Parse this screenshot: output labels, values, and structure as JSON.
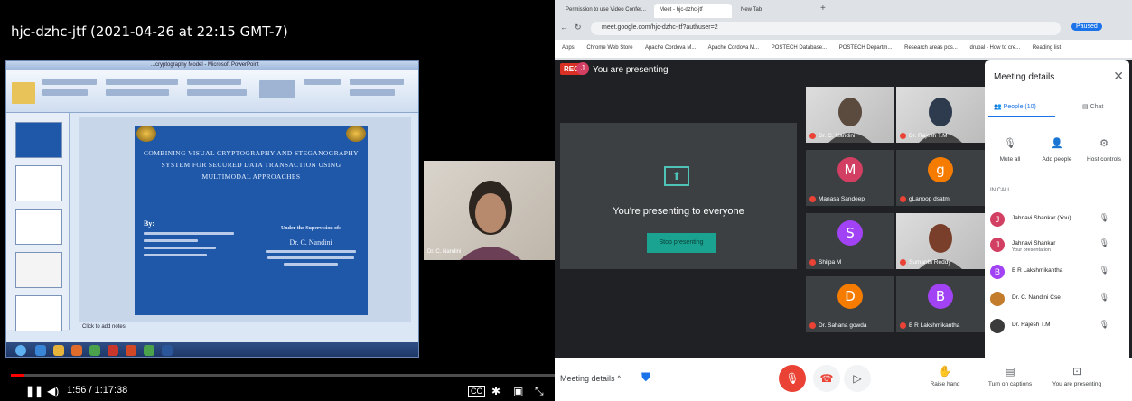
{
  "youtube": {
    "title": "hjc-dzhc-jtf (2021-04-26 at 22:15 GMT-7)",
    "time": "1:56 / 1:17:38",
    "progress_fraction": 0.025,
    "progress_color": "#ff0000"
  },
  "ppt": {
    "window_title": "...cryptography Model - Microsoft PowerPoint",
    "slide_title": "COMBINING VISUAL CRYPTOGRAPHY AND STEGANOGRAPHY SYSTEM FOR SECURED DATA TRANSACTION USING MULTIMODAL APPROACHES",
    "by_label": "By:",
    "supervision": "Under the Supervision of:",
    "supervisor": "Dr. C. Nandini",
    "notes": "Click to add notes"
  },
  "cam_left": {
    "name": "Dr. C. Nandini"
  },
  "browser": {
    "tabs": [
      "Permission to use Video Confer...",
      "Meet - hjc-dzhc-jtf",
      "New Tab"
    ],
    "url": "meet.google.com/hjc-dzhc-jtf?authuser=2",
    "paused_label": "Paused",
    "bookmarks": [
      "Apps",
      "Chrome Web Store",
      "Apache Cordova M...",
      "Apache Cordova M...",
      "POSTECH Database...",
      "POSTECH Departm...",
      "Research areas pos...",
      "drupal - How to cre..."
    ],
    "reading_list": "Reading list"
  },
  "meet": {
    "rec_label": "REC",
    "presenter_initial": "J",
    "you_presenting": "You are presenting",
    "presenting_text": "You're presenting to everyone",
    "stop_button": "Stop presenting",
    "tiles": [
      {
        "name": "Dr. C. Nandini",
        "initial": "",
        "color": "#5b4a3e",
        "video": true
      },
      {
        "name": "Dr. Rajesh T.M",
        "initial": "",
        "color": "#2e3b4e",
        "video": true
      },
      {
        "name": "Manasa Sandeep",
        "initial": "M",
        "color": "#d23f62"
      },
      {
        "name": "gLanoop dsatm",
        "initial": "g",
        "color": "#f57c00"
      },
      {
        "name": "Shilpa M",
        "initial": "S",
        "color": "#a142f4"
      },
      {
        "name": "Sumanth Reddy",
        "initial": "",
        "color": "#7a3f2a",
        "video": true
      },
      {
        "name": "Dr. Sahana gowda",
        "initial": "D",
        "color": "#f57c00"
      },
      {
        "name": "B R Lakshmikantha",
        "initial": "B",
        "color": "#a142f4"
      }
    ]
  },
  "sidebar": {
    "title": "Meeting details",
    "tab_people": "People (10)",
    "tab_chat": "Chat",
    "actions": [
      "Mute all",
      "Add people",
      "Host controls"
    ],
    "in_call": "IN CALL",
    "participants": [
      {
        "name": "Jahnavi Shankar (You)",
        "sub": "",
        "initial": "J",
        "color": "#d23f62"
      },
      {
        "name": "Jahnavi Shankar",
        "sub": "Your presentation",
        "initial": "J",
        "color": "#d23f62"
      },
      {
        "name": "B R Lakshmikantha",
        "sub": "",
        "initial": "B",
        "color": "#a142f4"
      },
      {
        "name": "Dr. C. Nandini Cse",
        "sub": "",
        "initial": "",
        "color": "#c27c2c"
      },
      {
        "name": "Dr. Rajesh T.M",
        "sub": "",
        "initial": "",
        "color": "#3b3b3b"
      }
    ]
  },
  "bottom_bar": {
    "details_label": "Meeting details",
    "raise_hand": "Raise hand",
    "captions": "Turn on captions",
    "presenting": "You are presenting"
  }
}
